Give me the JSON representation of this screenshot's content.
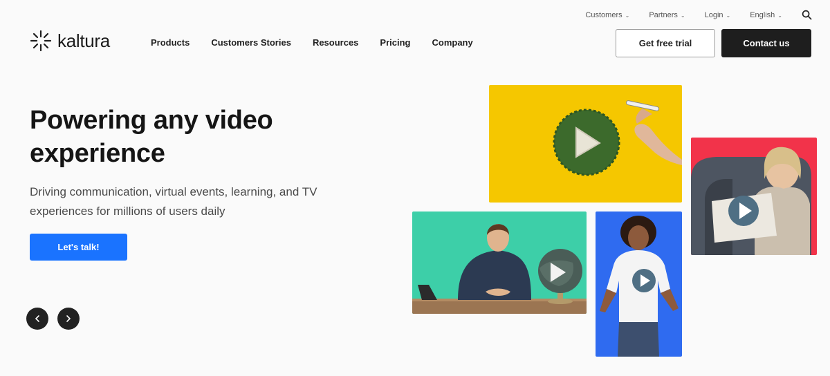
{
  "utility": {
    "customers": "Customers",
    "partners": "Partners",
    "login": "Login",
    "language": "English",
    "search_icon": "search-icon"
  },
  "brand": {
    "logo_text": "kaltura",
    "logo_icon": "spark-icon"
  },
  "nav": {
    "items": [
      "Products",
      "Customers Stories",
      "Resources",
      "Pricing",
      "Company"
    ]
  },
  "actions": {
    "trial": "Get free trial",
    "contact": "Contact us"
  },
  "hero": {
    "title": "Powering any video experience",
    "subtitle": "Driving communication, virtual events, learning, and TV experiences for millions of users daily",
    "cta": "Let's talk!"
  },
  "carousel": {
    "prev_icon": "chevron-left-icon",
    "next_icon": "chevron-right-icon"
  },
  "colors": {
    "accent": "#1a73ff",
    "dark": "#1e1e1e",
    "tile_yellow": "#f5c700",
    "tile_red": "#f2334a",
    "tile_green": "#3dcfa8",
    "tile_blue": "#2f6bf0"
  }
}
